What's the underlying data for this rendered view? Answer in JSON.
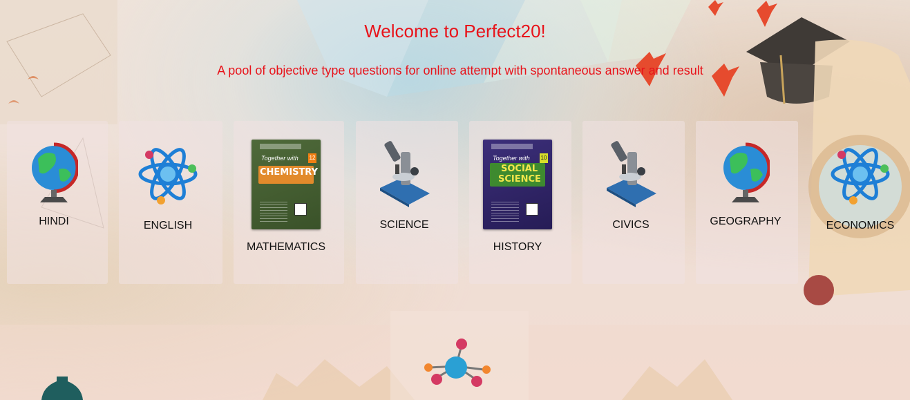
{
  "page": {
    "welcome": "Welcome to Perfect20!",
    "tagline": "A pool of objective type questions for online attempt with spontaneous answer and result"
  },
  "subjects": [
    {
      "label": "HINDI",
      "icon": "globe-icon"
    },
    {
      "label": "ENGLISH",
      "icon": "atom-icon"
    },
    {
      "label": "MATHEMATICS",
      "icon": "chemistry-book-icon",
      "book_title": "CHEMISTRY",
      "book_class": "12",
      "book_tag": "Together with"
    },
    {
      "label": "SCIENCE",
      "icon": "microscope-icon"
    },
    {
      "label": "HISTORY",
      "icon": "social-science-book-icon",
      "book_title_line1": "SOCIAL",
      "book_title_line2": "SCIENCE",
      "book_class": "10",
      "book_tag": "Together with"
    },
    {
      "label": "CIVICS",
      "icon": "microscope-icon"
    },
    {
      "label": "GEOGRAPHY",
      "icon": "globe-icon"
    },
    {
      "label": "ECONOMICS",
      "icon": "atom-icon"
    }
  ],
  "colors": {
    "heading": "#e8131a",
    "label": "#111111",
    "card": "#f0e1e1"
  }
}
